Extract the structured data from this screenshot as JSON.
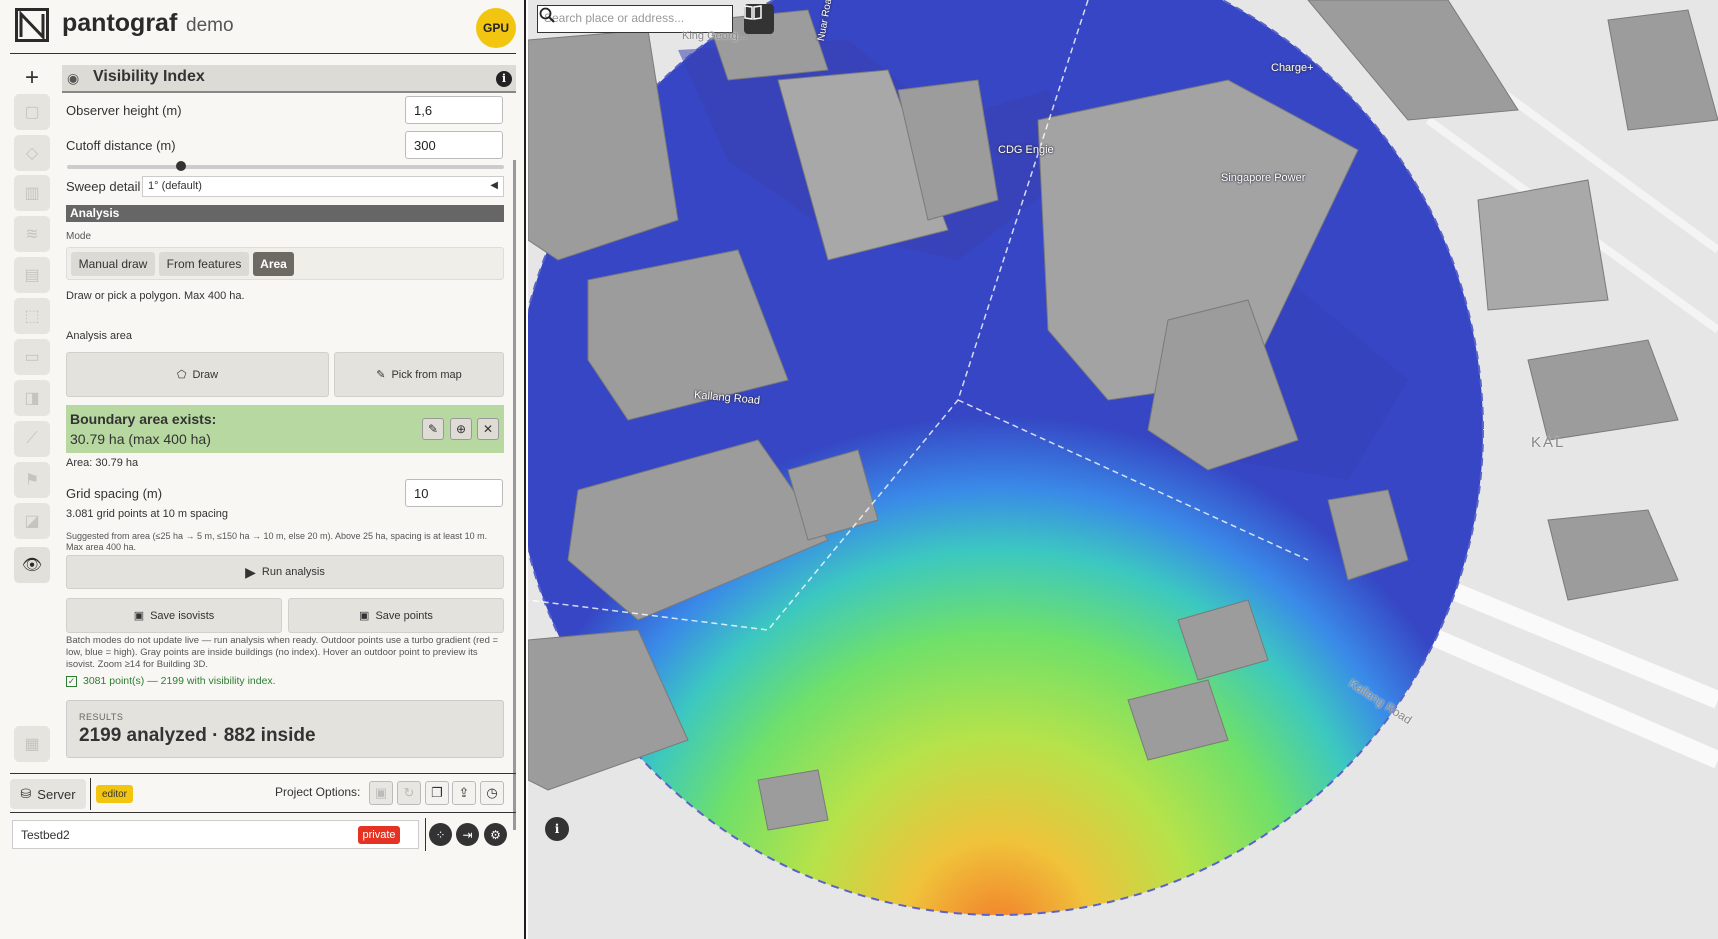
{
  "header": {
    "app_name": "pantograf",
    "app_sub": "demo",
    "gpu_badge": "GPU"
  },
  "panel": {
    "title": "Visibility Index",
    "observer_height_label": "Observer height (m)",
    "observer_height_value": "1,6",
    "cutoff_label": "Cutoff distance (m)",
    "cutoff_value": "300",
    "cutoff_slider_fraction": 0.26,
    "sweep_label": "Sweep detail",
    "sweep_value": "1° (default)",
    "analysis_heading": "Analysis",
    "mode_label": "Mode",
    "modes": [
      "Manual draw",
      "From features",
      "Area"
    ],
    "active_mode": "Area",
    "mode_hint": "Draw or pick a polygon. Max 400 ha.",
    "analysis_area_label": "Analysis area",
    "draw_button": "Draw",
    "pick_button": "Pick from map",
    "boundary_title": "Boundary area exists:",
    "boundary_value": "30.79 ha (max 400 ha)",
    "area_text": "Area: 30.79 ha",
    "grid_label": "Grid spacing (m)",
    "grid_value": "10",
    "grid_info": "3.081 grid points at 10 m spacing",
    "suggest_text": "Suggested from area (≤25 ha → 5 m, ≤150 ha → 10 m, else 20 m). Above 25 ha, spacing is at least 10 m. Max area 400 ha.",
    "run_button": "Run analysis",
    "save_isovists": "Save isovists",
    "save_points": "Save points",
    "batch_note": "Batch modes do not update live — run analysis when ready. Outdoor points use a turbo gradient (red = low, blue = high). Gray points are inside buildings (no index). Hover an outdoor point to preview its isovist. Zoom ≥14 for Building 3D.",
    "status_text": "3081 point(s) — 2199 with visibility index.",
    "results_label": "RESULTS",
    "results_value": "2199 analyzed · 882 inside"
  },
  "footer": {
    "server_label": "Server",
    "editor_badge": "editor",
    "project_options_label": "Project Options:",
    "project_name": "Testbed2",
    "private_badge": "private"
  },
  "map": {
    "search_placeholder": "Search place or address...",
    "labels": {
      "king_george": "King Georg...",
      "charge_plus": "Charge+",
      "cdg_engie": "CDG Engie",
      "singapore_power": "Singapore Power",
      "kallang_road_1": "Kallang Road",
      "kallang_road_2": "Kallang Road",
      "kal": "KAL",
      "street_vertical": "Nuar Road"
    },
    "attribution_glyph": "i"
  },
  "colors": {
    "accent": "#f2c511",
    "private": "#e53222",
    "boundary": "#b7d8a0",
    "status_green": "#2e7d32"
  }
}
